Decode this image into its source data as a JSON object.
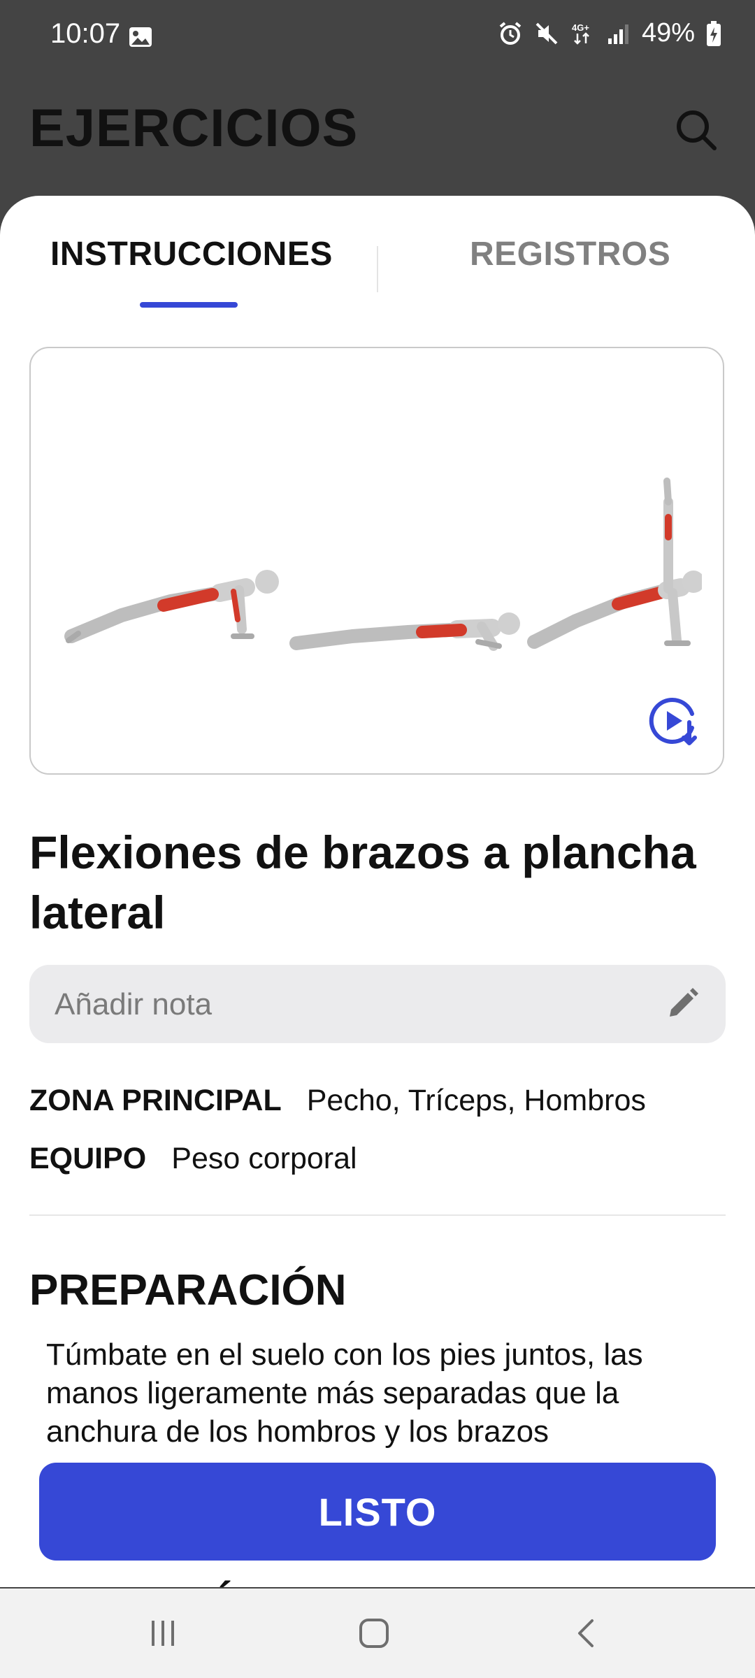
{
  "status_bar": {
    "time": "10:07",
    "battery": "49%",
    "icons": [
      "gallery-icon",
      "alarm-icon",
      "mute-icon",
      "4g-icon",
      "signal-icon",
      "battery-charging-icon"
    ]
  },
  "header": {
    "title": "EJERCICIOS",
    "search_icon": "search-icon"
  },
  "tabs": [
    {
      "label": "INSTRUCCIONES",
      "active": true
    },
    {
      "label": "REGISTROS",
      "active": false
    }
  ],
  "media": {
    "video_icon": "play-download-icon"
  },
  "exercise": {
    "title": "Flexiones de brazos a plancha lateral",
    "note_placeholder": "Añadir nota",
    "meta": {
      "zona_label": "ZONA PRINCIPAL",
      "zona_value": "Pecho, Tríceps, Hombros",
      "equipo_label": "EQUIPO",
      "equipo_value": "Peso corporal"
    },
    "preparation": {
      "heading": "PREPARACIÓN",
      "text": "Túmbate en el suelo con los pies juntos, las manos ligeramente más separadas que la anchura de los hombros y los brazos"
    },
    "peek_text": "´"
  },
  "actions": {
    "done_label": "LISTO"
  },
  "colors": {
    "accent": "#3648d6",
    "header_bg": "#444444",
    "muscle": "#d23a2a"
  }
}
